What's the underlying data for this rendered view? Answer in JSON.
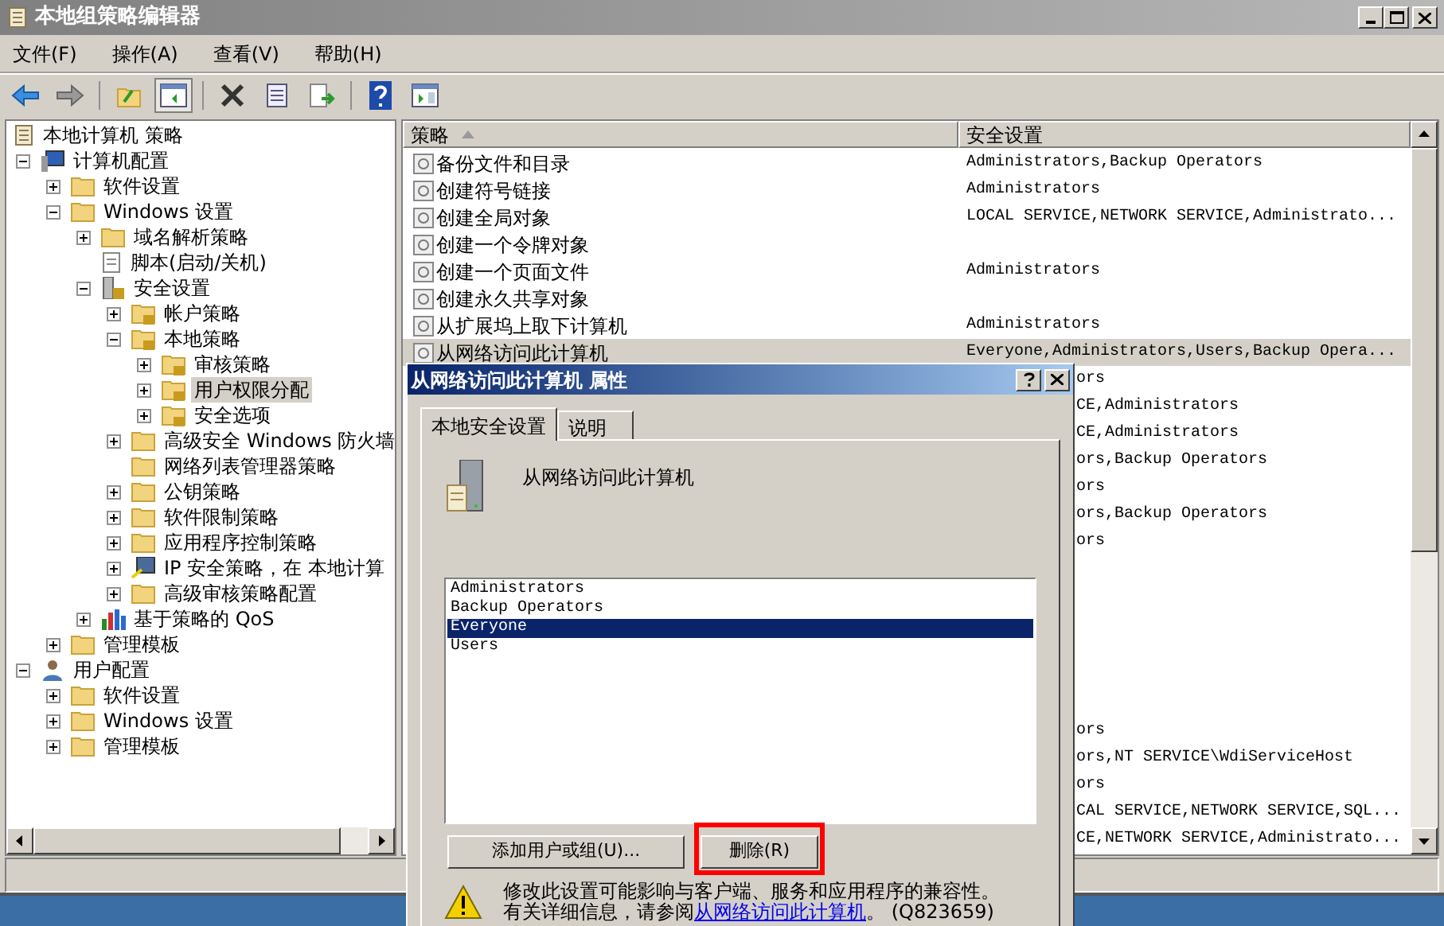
{
  "window": {
    "title": "本地组策略编辑器"
  },
  "menu": [
    "文件(F)",
    "操作(A)",
    "查看(V)",
    "帮助(H)"
  ],
  "toolbar": [
    {
      "buttons": [
        {
          "kind": "back",
          "pressed": false
        },
        {
          "kind": "forward",
          "pressed": false
        }
      ]
    },
    {
      "buttons": [
        {
          "kind": "up",
          "pressed": false
        },
        {
          "kind": "tree",
          "pressed": true
        }
      ]
    },
    {
      "buttons": [
        {
          "kind": "delete",
          "pressed": false
        },
        {
          "kind": "properties",
          "pressed": false
        },
        {
          "kind": "export",
          "pressed": false
        }
      ]
    },
    {
      "buttons": [
        {
          "kind": "help",
          "pressed": false
        },
        {
          "kind": "pane",
          "pressed": false
        }
      ]
    }
  ],
  "tree": [
    {
      "label": "本地计算机 策略",
      "kind": "root",
      "selected": false,
      "children": [
        {
          "label": "计算机配置",
          "kind": "computer",
          "selected": false,
          "expanded": true,
          "children": [
            {
              "label": "软件设置",
              "kind": "folder",
              "selected": false,
              "expanded": false
            },
            {
              "label": "Windows 设置",
              "kind": "folder",
              "selected": false,
              "expanded": true,
              "children": [
                {
                  "label": "域名解析策略",
                  "kind": "folder",
                  "selected": false,
                  "expanded": false
                },
                {
                  "label": "脚本(启动/关机)",
                  "kind": "script",
                  "selected": false
                },
                {
                  "label": "安全设置",
                  "kind": "secure",
                  "selected": false,
                  "expanded": true,
                  "children": [
                    {
                      "label": "帐户策略",
                      "kind": "lockfolder",
                      "selected": false,
                      "expanded": false
                    },
                    {
                      "label": "本地策略",
                      "kind": "lockfolder",
                      "selected": false,
                      "expanded": true,
                      "children": [
                        {
                          "label": "审核策略",
                          "kind": "lockfolder",
                          "selected": false,
                          "expanded": false
                        },
                        {
                          "label": "用户权限分配",
                          "kind": "lockfolder",
                          "selected": true,
                          "expanded": false
                        },
                        {
                          "label": "安全选项",
                          "kind": "lockfolder",
                          "selected": false,
                          "expanded": false
                        }
                      ]
                    },
                    {
                      "label": "高级安全 Windows 防火墙",
                      "kind": "folder",
                      "selected": false,
                      "expanded": false
                    },
                    {
                      "label": "网络列表管理器策略",
                      "kind": "folder",
                      "selected": false
                    },
                    {
                      "label": "公钥策略",
                      "kind": "folder",
                      "selected": false,
                      "expanded": false
                    },
                    {
                      "label": "软件限制策略",
                      "kind": "folder",
                      "selected": false,
                      "expanded": false
                    },
                    {
                      "label": "应用程序控制策略",
                      "kind": "folder",
                      "selected": false,
                      "expanded": false
                    },
                    {
                      "label": "IP 安全策略，在 本地计算",
                      "kind": "ip",
                      "selected": false,
                      "expanded": false
                    },
                    {
                      "label": "高级审核策略配置",
                      "kind": "folder",
                      "selected": false,
                      "expanded": false
                    }
                  ]
                },
                {
                  "label": "基于策略的 QoS",
                  "kind": "chart",
                  "selected": false,
                  "expanded": false
                }
              ]
            },
            {
              "label": "管理模板",
              "kind": "folder",
              "selected": false,
              "expanded": false
            }
          ]
        },
        {
          "label": "用户配置",
          "kind": "user",
          "selected": false,
          "expanded": true,
          "children": [
            {
              "label": "软件设置",
              "kind": "folder",
              "selected": false,
              "expanded": false
            },
            {
              "label": "Windows 设置",
              "kind": "folder",
              "selected": false,
              "expanded": false
            },
            {
              "label": "管理模板",
              "kind": "folder",
              "selected": false,
              "expanded": false
            }
          ]
        }
      ]
    }
  ],
  "list": {
    "columns": [
      "策略",
      "安全设置"
    ],
    "rows": [
      {
        "policy": "备份文件和目录",
        "setting": "Administrators,Backup Operators",
        "selected": false
      },
      {
        "policy": "创建符号链接",
        "setting": "Administrators",
        "selected": false
      },
      {
        "policy": "创建全局对象",
        "setting": "LOCAL SERVICE,NETWORK SERVICE,Administrato...",
        "selected": false
      },
      {
        "policy": "创建一个令牌对象",
        "selected": false
      },
      {
        "policy": "创建一个页面文件",
        "setting": "Administrators",
        "selected": false
      },
      {
        "policy": "创建永久共享对象",
        "selected": false
      },
      {
        "policy": "从扩展坞上取下计算机",
        "setting": "Administrators",
        "selected": false
      },
      {
        "policy": "从网络访问此计算机",
        "setting": "Everyone,Administrators,Users,Backup Opera...",
        "selected": true
      }
    ],
    "covered_rows": [
      {
        "setting": "ors"
      },
      {
        "setting": "CE,Administrators"
      },
      {
        "setting": "CE,Administrators"
      },
      {
        "setting": "ors,Backup Operators"
      },
      {
        "setting": "ors"
      },
      {
        "setting": "ors,Backup Operators"
      },
      {
        "setting": "ors"
      },
      {
        "setting": "ors"
      },
      {
        "setting": "ors,NT SERVICE\\WdiServiceHost"
      },
      {
        "setting": "ors"
      },
      {
        "setting": "CAL SERVICE,NETWORK SERVICE,SQL..."
      },
      {
        "setting": "CE,NETWORK SERVICE,Administrato..."
      }
    ]
  },
  "dialog": {
    "title": "从网络访问此计算机 属性",
    "tabs": [
      {
        "label": "本地安全设置",
        "selected": true
      },
      {
        "label": "说明",
        "selected": false
      }
    ],
    "policy_name": "从网络访问此计算机",
    "accounts": [
      {
        "name": "Administrators",
        "selected": false
      },
      {
        "name": "Backup Operators",
        "selected": false
      },
      {
        "name": "Everyone",
        "selected": true
      },
      {
        "name": "Users",
        "selected": false
      }
    ],
    "buttons": [
      {
        "label": "添加用户或组(U)...",
        "highlighted": false
      },
      {
        "label": "删除(R)",
        "highlighted": true
      }
    ],
    "warning": "修改此设置可能影响与客户端、服务和应用程序的兼容性。",
    "info_prefix": "有关详细信息，请参阅",
    "info_link": "从网络访问此计算机",
    "info_suffix": "。 (Q823659)"
  }
}
